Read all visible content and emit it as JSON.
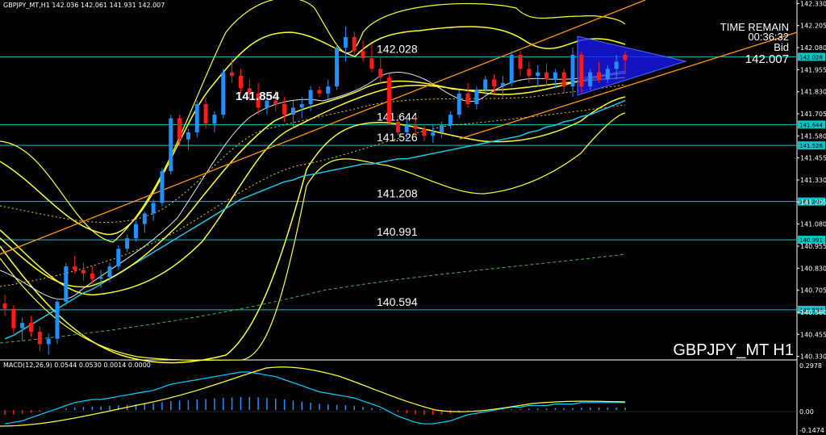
{
  "header": {
    "text": "GBPJPY_MT,H1  142.036 142.061 141.931 142.007"
  },
  "symbol_label": "GBPJPY_MT H1",
  "time_remain": {
    "title": "TIME REMAIN",
    "value": "00:36:32",
    "bid_label": "Bid",
    "bid_value": "142.007"
  },
  "macd": {
    "label": "MACD(12,26,9) 0.0544 0.0530 0.0014 0.0000",
    "axis_top": "0.2978",
    "axis_zero": "0.00",
    "axis_bottom": "-0.1474"
  },
  "colors": {
    "background": "#000000",
    "bull": "#1e90ff",
    "bear": "#ff1a1a",
    "level": "#00c8c8",
    "band": "#ffff33",
    "trend": "#ff9900",
    "ma": "#19c8e6",
    "triangle": "#1a1aff"
  },
  "chart_data": {
    "type": "candlestick",
    "ylim": [
      140.31,
      142.35
    ],
    "y_ticks": [
      "142.330",
      "142.205",
      "142.080",
      "141.955",
      "141.830",
      "141.705",
      "141.580",
      "141.455",
      "141.330",
      "141.205",
      "141.080",
      "140.955",
      "140.830",
      "140.705",
      "140.580",
      "140.455",
      "140.330"
    ],
    "levels": [
      {
        "value": 142.028,
        "label": "142.028"
      },
      {
        "value": 141.644,
        "label": "141.644"
      },
      {
        "value": 141.526,
        "label": "141.526"
      },
      {
        "value": 141.208,
        "label": "141.208"
      },
      {
        "value": 140.991,
        "label": "140.991"
      },
      {
        "value": 140.594,
        "label": "140.594"
      }
    ],
    "annotations": [
      {
        "value": 141.854,
        "label": "141.854"
      }
    ],
    "candles": [
      [
        140.63,
        140.68,
        140.56,
        140.6
      ],
      [
        140.6,
        140.62,
        140.46,
        140.49
      ],
      [
        140.49,
        140.55,
        140.42,
        140.52
      ],
      [
        140.52,
        140.56,
        140.44,
        140.47
      ],
      [
        140.47,
        140.5,
        140.36,
        140.4
      ],
      [
        140.4,
        140.46,
        140.34,
        140.43
      ],
      [
        140.43,
        140.66,
        140.4,
        140.64
      ],
      [
        140.64,
        140.86,
        140.62,
        140.84
      ],
      [
        140.84,
        140.9,
        140.8,
        140.82
      ],
      [
        140.82,
        140.86,
        140.76,
        140.8
      ],
      [
        140.8,
        140.84,
        140.74,
        140.77
      ],
      [
        140.77,
        140.82,
        140.72,
        140.78
      ],
      [
        140.78,
        140.86,
        140.75,
        140.84
      ],
      [
        140.84,
        140.96,
        140.82,
        140.94
      ],
      [
        140.94,
        141.02,
        140.92,
        141.0
      ],
      [
        141.0,
        141.1,
        140.98,
        141.08
      ],
      [
        141.08,
        141.15,
        141.03,
        141.14
      ],
      [
        141.14,
        141.22,
        141.1,
        141.2
      ],
      [
        141.2,
        141.4,
        141.18,
        141.38
      ],
      [
        141.38,
        141.7,
        141.36,
        141.68
      ],
      [
        141.68,
        141.7,
        141.52,
        141.56
      ],
      [
        141.56,
        141.62,
        141.5,
        141.6
      ],
      [
        141.6,
        141.78,
        141.57,
        141.76
      ],
      [
        141.76,
        141.8,
        141.62,
        141.65
      ],
      [
        141.65,
        141.72,
        141.6,
        141.7
      ],
      [
        141.7,
        141.96,
        141.68,
        141.94
      ],
      [
        141.94,
        142.02,
        141.88,
        141.92
      ],
      [
        141.92,
        141.96,
        141.82,
        141.85
      ],
      [
        141.85,
        141.9,
        141.78,
        141.82
      ],
      [
        141.82,
        141.88,
        141.7,
        141.74
      ],
      [
        141.74,
        141.8,
        141.7,
        141.78
      ],
      [
        141.78,
        141.84,
        141.72,
        141.76
      ],
      [
        141.76,
        141.8,
        141.66,
        141.7
      ],
      [
        141.7,
        141.78,
        141.62,
        141.74
      ],
      [
        141.74,
        141.8,
        141.68,
        141.76
      ],
      [
        141.76,
        141.86,
        141.72,
        141.84
      ],
      [
        141.84,
        141.86,
        141.8,
        141.82
      ],
      [
        141.82,
        141.9,
        141.78,
        141.86
      ],
      [
        141.86,
        142.1,
        141.84,
        142.08
      ],
      [
        142.08,
        142.2,
        142.0,
        142.14
      ],
      [
        142.14,
        142.17,
        142.04,
        142.06
      ],
      [
        142.06,
        142.12,
        142.0,
        142.02
      ],
      [
        142.02,
        142.1,
        141.94,
        141.96
      ],
      [
        141.96,
        142.03,
        141.88,
        141.91
      ],
      [
        141.91,
        141.93,
        141.64,
        141.66
      ],
      [
        141.66,
        141.7,
        141.58,
        141.6
      ],
      [
        141.6,
        141.68,
        141.55,
        141.64
      ],
      [
        141.64,
        141.7,
        141.58,
        141.62
      ],
      [
        141.62,
        141.65,
        141.55,
        141.58
      ],
      [
        141.58,
        141.64,
        141.54,
        141.6
      ],
      [
        141.6,
        141.66,
        141.57,
        141.64
      ],
      [
        141.64,
        141.72,
        141.62,
        141.7
      ],
      [
        141.7,
        141.84,
        141.68,
        141.82
      ],
      [
        141.82,
        141.88,
        141.74,
        141.76
      ],
      [
        141.76,
        141.86,
        141.73,
        141.84
      ],
      [
        141.84,
        141.92,
        141.8,
        141.9
      ],
      [
        141.9,
        141.93,
        141.82,
        141.86
      ],
      [
        141.86,
        141.92,
        141.8,
        141.88
      ],
      [
        141.88,
        142.06,
        141.86,
        142.04
      ],
      [
        142.04,
        142.06,
        141.92,
        141.96
      ],
      [
        141.96,
        142.0,
        141.88,
        141.92
      ],
      [
        141.92,
        141.98,
        141.86,
        141.94
      ],
      [
        141.94,
        141.99,
        141.86,
        141.9
      ],
      [
        141.9,
        141.96,
        141.85,
        141.94
      ],
      [
        141.94,
        141.96,
        141.82,
        141.86
      ],
      [
        141.86,
        142.08,
        141.8,
        142.04
      ],
      [
        142.04,
        142.06,
        141.82,
        141.86
      ],
      [
        141.86,
        141.96,
        141.84,
        141.94
      ],
      [
        141.94,
        142.0,
        141.88,
        141.9
      ],
      [
        141.9,
        141.98,
        141.88,
        141.96
      ],
      [
        141.96,
        142.04,
        141.9,
        142.0
      ],
      [
        142.04,
        142.06,
        141.93,
        142.01
      ]
    ],
    "macd_values": [
      -0.09,
      -0.08,
      -0.07,
      -0.05,
      -0.03,
      -0.01,
      0.01,
      0.03,
      0.05,
      0.06,
      0.07,
      0.07,
      0.08,
      0.09,
      0.1,
      0.11,
      0.12,
      0.13,
      0.15,
      0.17,
      0.18,
      0.19,
      0.2,
      0.21,
      0.22,
      0.23,
      0.24,
      0.25,
      0.25,
      0.24,
      0.23,
      0.22,
      0.2,
      0.18,
      0.16,
      0.14,
      0.12,
      0.11,
      0.1,
      0.09,
      0.08,
      0.06,
      0.04,
      0.02,
      -0.01,
      -0.04,
      -0.06,
      -0.08,
      -0.09,
      -0.09,
      -0.08,
      -0.07,
      -0.05,
      -0.03,
      -0.02,
      -0.01,
      0.0,
      0.01,
      0.02,
      0.02,
      0.03,
      0.03,
      0.03,
      0.04,
      0.04,
      0.04,
      0.05,
      0.05,
      0.05,
      0.05,
      0.05,
      0.05
    ],
    "ma_series": [
      {
        "values": [
          140.43,
          140.45,
          140.48,
          140.51,
          140.54,
          140.57,
          140.6,
          140.63,
          140.66,
          140.69,
          140.71,
          140.74,
          140.77,
          140.8,
          140.83,
          140.86,
          140.89,
          140.92,
          140.95,
          140.98,
          141.01,
          141.04,
          141.07,
          141.1,
          141.13,
          141.16,
          141.19,
          141.22,
          141.24,
          141.26,
          141.28,
          141.3,
          141.32,
          141.33,
          141.35,
          141.36,
          141.37,
          141.38,
          141.39,
          141.4,
          141.41,
          141.42,
          141.42,
          141.43,
          141.44,
          141.45,
          141.45,
          141.46,
          141.47,
          141.48,
          141.49,
          141.5,
          141.51,
          141.52,
          141.53,
          141.54,
          141.55,
          141.56,
          141.57,
          141.58,
          141.6,
          141.61,
          141.63,
          141.64,
          141.66,
          141.67,
          141.69,
          141.7,
          141.72,
          141.74,
          141.76,
          141.78
        ]
      }
    ]
  }
}
